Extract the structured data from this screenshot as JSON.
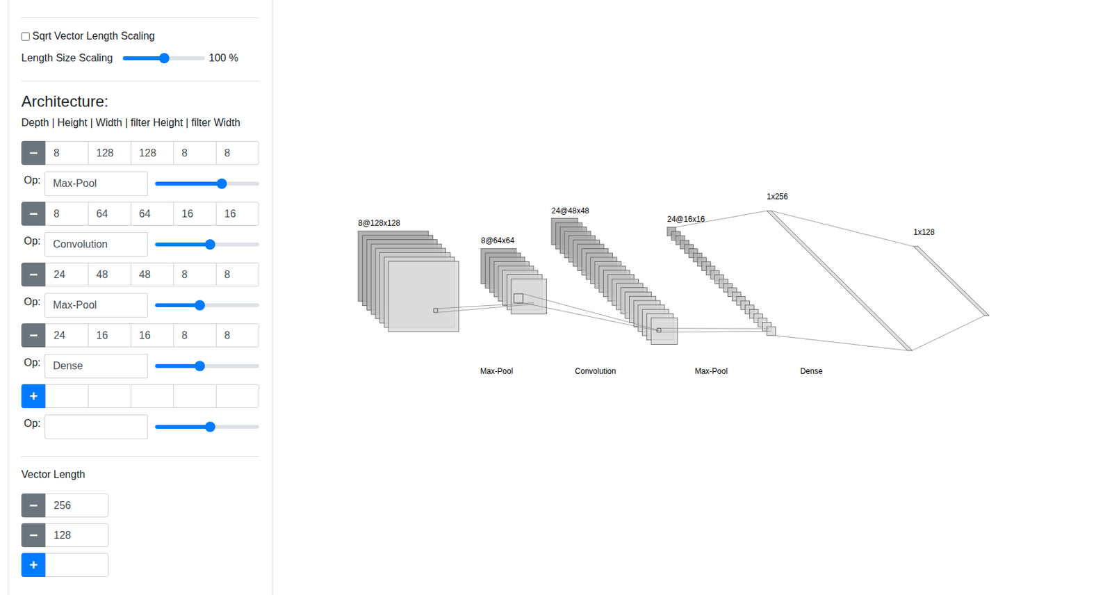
{
  "display": {
    "sqrt_scaling": {
      "label": "Sqrt Vector Length Scaling",
      "checked": false
    },
    "length_scaling": {
      "label": "Length Size Scaling",
      "level": 0.5,
      "reading": "100 %"
    }
  },
  "architecture": {
    "title": "Architecture:",
    "header": "Depth | Height | Width | filter Height | filter Width",
    "op_label": "Op:",
    "remove_icon": "−",
    "add_icon": "+",
    "layers": [
      {
        "fields": [
          "8",
          "128",
          "128",
          "8",
          "8"
        ],
        "op": "Max-Pool",
        "level": 0.64
      },
      {
        "fields": [
          "8",
          "64",
          "64",
          "16",
          "16"
        ],
        "op": "Convolution",
        "level": 0.53
      },
      {
        "fields": [
          "24",
          "48",
          "48",
          "8",
          "8"
        ],
        "op": "Max-Pool",
        "level": 0.43
      },
      {
        "fields": [
          "24",
          "16",
          "16",
          "8",
          "8"
        ],
        "op": "Dense",
        "level": 0.43
      }
    ],
    "new_layer": {
      "fields": [
        "",
        "",
        "",
        "",
        ""
      ],
      "op": "",
      "level": 0.53
    }
  },
  "vectors": {
    "title": "Vector Length",
    "items": [
      "256",
      "128"
    ],
    "new_item": ""
  },
  "diagram": {
    "map_labels": [
      "8@128x128",
      "8@64x64",
      "24@48x48",
      "24@16x16"
    ],
    "vector_labels": [
      "1x256",
      "1x128"
    ],
    "ops": [
      "Max-Pool",
      "Convolution",
      "Max-Pool",
      "Dense"
    ]
  }
}
